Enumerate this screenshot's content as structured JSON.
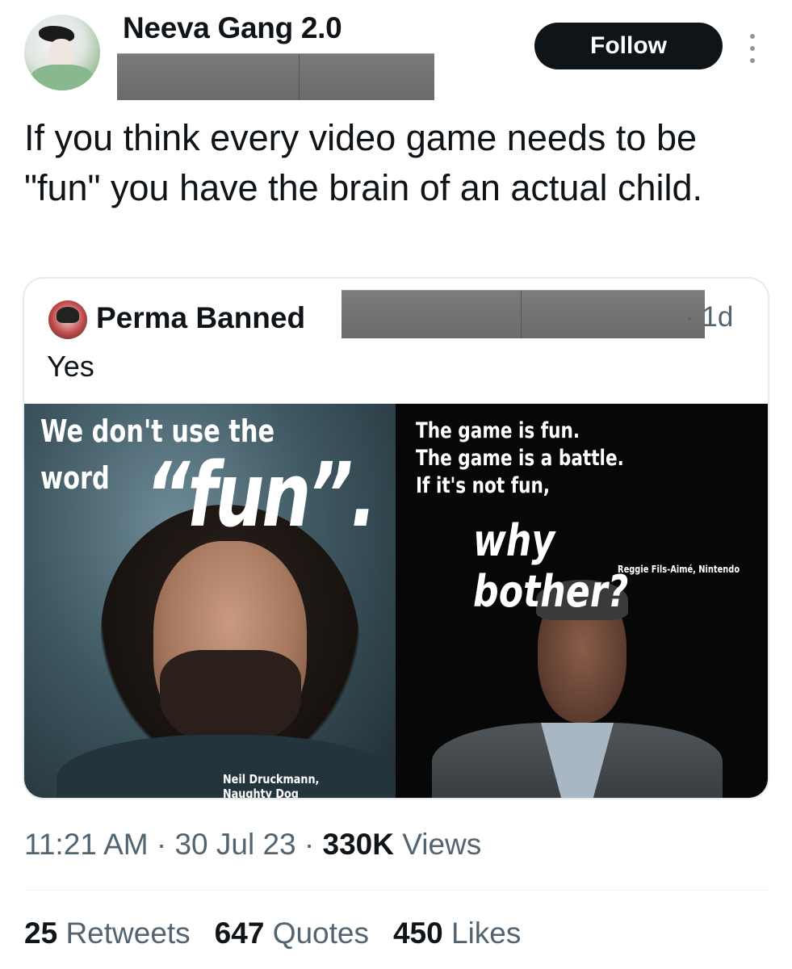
{
  "author": {
    "display_name": "Neeva Gang 2.0",
    "avatar_icon": "user-avatar-icon"
  },
  "follow_label": "Follow",
  "more_icon": "more-options-icon",
  "tweet_text": "If you think every video game needs to be \"fun\" you have the brain of an actual child.",
  "quoted": {
    "display_name": "Perma Banned",
    "time": "· 1d",
    "text": "Yes",
    "media": {
      "left_head": "We don't use the",
      "left_word": "word",
      "left_fun": "“fun”.",
      "left_credit": "Neil Druckmann, Naughty Dog",
      "right_line1": "The game is fun.",
      "right_line2": "The game is a battle.",
      "right_line3": "If it's not fun,",
      "right_why": "why bother?",
      "right_credit": "Reggie Fils-Aimé, Nintendo"
    }
  },
  "meta": {
    "time_date": "11:21 AM · 30 Jul 23 ·",
    "views_count": "330K",
    "views_label": "Views"
  },
  "stats": {
    "retweets_count": "25",
    "retweets_label": "Retweets",
    "quotes_count": "647",
    "quotes_label": "Quotes",
    "likes_count": "450",
    "likes_label": "Likes"
  },
  "colors": {
    "text_primary": "#0f1419",
    "text_secondary": "#536471",
    "follow_bg": "#0f1419",
    "border": "#e7ebee"
  }
}
